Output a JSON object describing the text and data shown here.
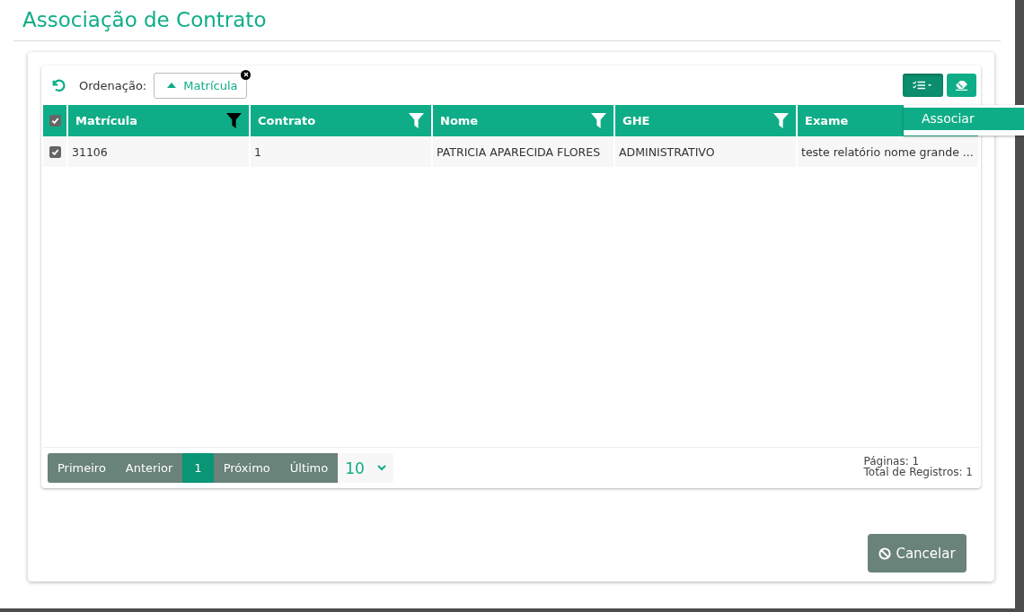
{
  "dialog": {
    "title": "Associação de Contrato"
  },
  "toolbar": {
    "sort_label": "Ordenação:",
    "sort_chip": {
      "label": "Matrícula",
      "ascending": true
    }
  },
  "actions_menu": {
    "expanded": true,
    "items": [
      {
        "label": "Associar",
        "selected": true
      }
    ]
  },
  "table": {
    "select_all": {
      "checked": true
    },
    "columns": [
      {
        "label": "Matrícula",
        "filter_active": true
      },
      {
        "label": "Contrato",
        "filter_active": false
      },
      {
        "label": "Nome",
        "filter_active": false
      },
      {
        "label": "GHE",
        "filter_active": false
      },
      {
        "label": "Exame"
      }
    ],
    "rows": [
      {
        "checked": true,
        "cells": [
          "31106",
          "1",
          "PATRICIA APARECIDA FLORES",
          "ADMINISTRATIVO",
          "teste relatório nome grande ..."
        ]
      }
    ]
  },
  "pagination": {
    "buttons": [
      {
        "label": "Primeiro",
        "selected": false
      },
      {
        "label": "Anterior",
        "selected": false
      },
      {
        "label": "1",
        "selected": true
      },
      {
        "label": "Próximo",
        "selected": false
      },
      {
        "label": "Último",
        "selected": false
      }
    ],
    "page_size": "10",
    "pages": "Páginas: 1",
    "total": "Total de Registros: 1"
  },
  "buttons": [
    {
      "label": "Cancelar"
    }
  ]
}
